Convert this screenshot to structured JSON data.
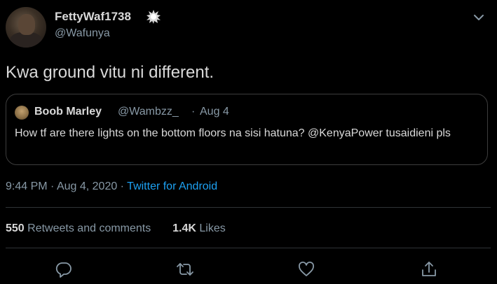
{
  "author": {
    "display_name": "FettyWaf1738",
    "handle": "@Wafunya"
  },
  "tweet": {
    "text": "Kwa ground vitu ni different."
  },
  "quoted": {
    "display_name": "Boob Marley",
    "handle": "@Wambzz_",
    "separator": "·",
    "date": "Aug 4",
    "text": "How tf are there lights on the bottom floors na sisi hatuna? @KenyaPower tusaidieni pls"
  },
  "meta": {
    "time": "9:44 PM",
    "sep1": " · ",
    "date": "Aug 4, 2020",
    "sep2": " · ",
    "source": "Twitter for Android"
  },
  "stats": {
    "retweets_count": "550",
    "retweets_label": "Retweets and comments",
    "likes_count": "1.4K",
    "likes_label": "Likes"
  },
  "icons": {
    "verified": "verified-badge-icon",
    "more": "chevron-down-icon",
    "reply": "reply-icon",
    "retweet": "retweet-icon",
    "like": "heart-icon",
    "share": "share-icon"
  },
  "colors": {
    "background": "#000000",
    "text": "#d9d9d9",
    "secondary": "#8899a6",
    "link": "#1da1f2",
    "border": "#3d3d3d"
  }
}
